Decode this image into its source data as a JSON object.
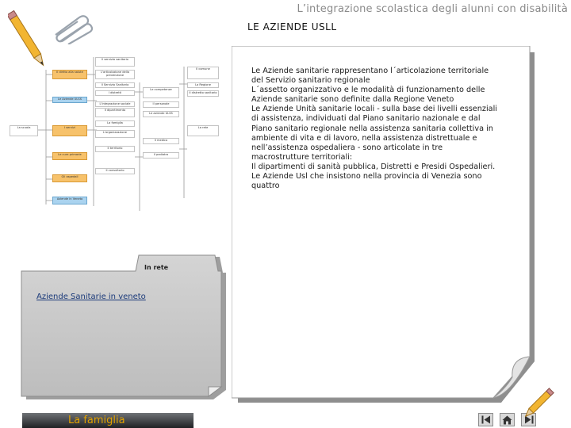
{
  "header": {
    "title": "L’integrazione scolastica degli alunni con disabilità",
    "subtitle": "LE AZIENDE USLL"
  },
  "diagram": {
    "nodes": [
      "Il servizio sanitario",
      "Il diritto alla salute",
      "L'articolazione della prevenzione",
      "Il comune",
      "Il Servizio Sanitario",
      "Le competenze",
      "La Regione",
      "Le Aziende ULSS",
      "I distretti",
      "Il distretto sanitario",
      "Il personale",
      "L'integrazione sociale",
      "Il dipartimento",
      "Le aziende ULSS",
      "La scuola",
      "I servizi",
      "La famiglia",
      "La rete",
      "L'organizzazione",
      "Il medico",
      "Le cure primarie",
      "Il territorio",
      "Il pediatra",
      "Gli ospedali",
      "Il consultorio",
      "Aziende in Veneto"
    ]
  },
  "folder": {
    "title": "In rete",
    "link": "Aziende Sanitarie in veneto"
  },
  "content": {
    "paragraphs": [
      "Le Aziende sanitarie rappresentano l´articolazione territoriale del Servizio sanitario regionale",
      "L´assetto organizzativo e le modalità di funzionamento delle Aziende sanitarie sono definite dalla Regione Veneto",
      "Le Aziende Unità sanitarie locali - sulla base dei livelli essenziali di assistenza, individuati dal Piano sanitario nazionale e dal Piano sanitario regionale nella assistenza sanitaria collettiva in ambiente di vita e di lavoro, nella assistenza distrettuale e nell’assistenza ospedaliera - sono articolate in tre macrostrutture territoriali:",
      "Il dipartimenti di sanità pubblica, Distretti e Presidi Ospedalieri.",
      "Le Aziende Usl che insistono nella provincia di Venezia sono quattro"
    ]
  },
  "footer": {
    "label": "La famiglia"
  },
  "colors": {
    "accent_orange": "#f7c26b",
    "accent_blue": "#aad3ef",
    "footer_text": "#e0a000"
  }
}
